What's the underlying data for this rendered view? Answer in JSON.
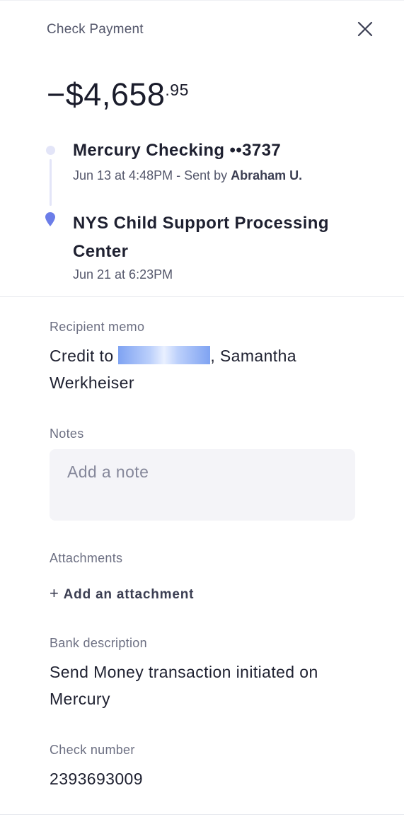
{
  "header": {
    "title": "Check Payment",
    "close_icon": "close-icon"
  },
  "amount": {
    "main": "−$4,658",
    "cents": ".95"
  },
  "timeline": {
    "from": {
      "account": "Mercury Checking ••3737",
      "date": "Jun 13 at 4:48PM - Sent by ",
      "sender": "Abraham U."
    },
    "to": {
      "recipient": "NYS Child Support Processing Center",
      "date": "Jun 21 at 6:23PM"
    },
    "colors": {
      "dot": "#e3e5f8",
      "pin": "#6b7de8"
    }
  },
  "recipient_memo": {
    "label": "Recipient memo",
    "prefix": "Credit to ",
    "suffix": ", Samantha Werkheiser"
  },
  "notes": {
    "label": "Notes",
    "placeholder": "Add a note"
  },
  "attachments": {
    "label": "Attachments",
    "add_label": "Add an attachment",
    "plus_icon": "plus-icon"
  },
  "bank_description": {
    "label": "Bank description",
    "value": "Send Money transaction initiated on Mercury"
  },
  "check_number": {
    "label": "Check number",
    "value": "2393693009"
  }
}
